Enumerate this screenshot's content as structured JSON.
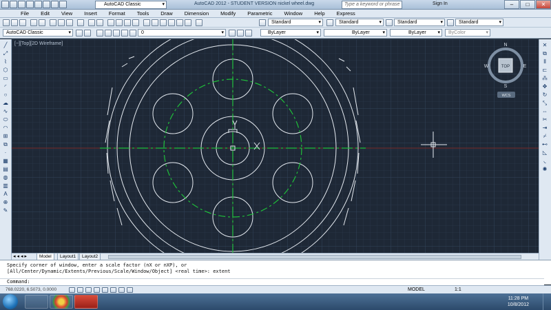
{
  "titlebar": {
    "workspace": "AutoCAD Classic",
    "title": "AutoCAD 2012 - STUDENT VERSION     nickel wheel.dwg",
    "search_placeholder": "Type a keyword or phrase",
    "signin": "Sign In",
    "minimize": "–",
    "maximize": "□",
    "close": "✕"
  },
  "menubar": {
    "items": [
      "File",
      "Edit",
      "View",
      "Insert",
      "Format",
      "Tools",
      "Draw",
      "Dimension",
      "Modify",
      "Parametric",
      "Window",
      "Help",
      "Express"
    ]
  },
  "toolbar1": {
    "workspace": "AutoCAD Classic",
    "text_style": "Standard",
    "dim_style": "Standard",
    "table_style": "Standard",
    "mleader_style": "Standard"
  },
  "toolbar2": {
    "layer": "0",
    "color": "ByLayer",
    "linetype": "ByLayer",
    "lineweight": "ByLayer",
    "plotstyle": "ByColor"
  },
  "viewport": {
    "label": "[−][Top][2D Wireframe]",
    "viewcube": {
      "top": "TOP",
      "n": "N",
      "s": "S",
      "e": "E",
      "w": "W",
      "wcs": "WCS"
    }
  },
  "colors": {
    "canvas_bg": "#1e2836",
    "geometry": "#e6ebf1",
    "centerline": "#1fbf3a",
    "red_axis": "#8a2a2a"
  },
  "tabs": [
    "Model",
    "Layout1",
    "Layout2"
  ],
  "command": {
    "history1": "Specify corner of window, enter a scale factor (nX or nXP), or",
    "history2": "[All/Center/Dynamic/Extents/Previous/Scale/Window/Object] <real time>: extent",
    "prompt": "Command:"
  },
  "status": {
    "coords": "768.0220, 6.5073, 0.0000",
    "model": "MODEL",
    "scale": "1:1"
  },
  "taskbar": {
    "time": "11:28 PM",
    "date": "10/8/2012"
  }
}
